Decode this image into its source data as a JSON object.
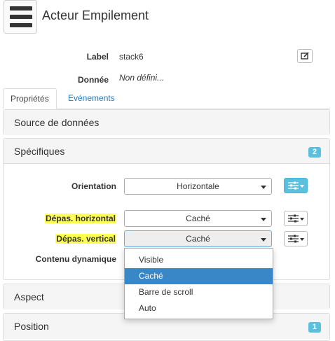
{
  "header": {
    "title": "Acteur Empilement"
  },
  "info": {
    "label_caption": "Label",
    "label_value": "stack6",
    "data_caption": "Donnée",
    "data_value": "Non défini..."
  },
  "tabs": [
    {
      "label": "Propriétés",
      "active": true
    },
    {
      "label": "Evénements",
      "active": false
    }
  ],
  "panels": {
    "source": {
      "title": "Source de données"
    },
    "specifiques": {
      "title": "Spécifiques",
      "badge": "2"
    },
    "aspect": {
      "title": "Aspect"
    },
    "position": {
      "title": "Position",
      "badge": "1"
    }
  },
  "fields": {
    "orientation": {
      "label": "Orientation",
      "value": "Horizontale"
    },
    "depas_h": {
      "label": "Dépas. horizontal",
      "value": "Caché"
    },
    "depas_v": {
      "label": "Dépas. vertical",
      "value": "Caché"
    },
    "contenu": {
      "label": "Contenu dynamique"
    }
  },
  "dropdown": {
    "options": [
      "Visible",
      "Caché",
      "Barre de scroll",
      "Auto"
    ],
    "selected": "Caché"
  },
  "colors": {
    "accent": "#5bc0de",
    "highlight": "#ffff54",
    "selection": "#3a87c8",
    "link": "#2a7ab8"
  }
}
